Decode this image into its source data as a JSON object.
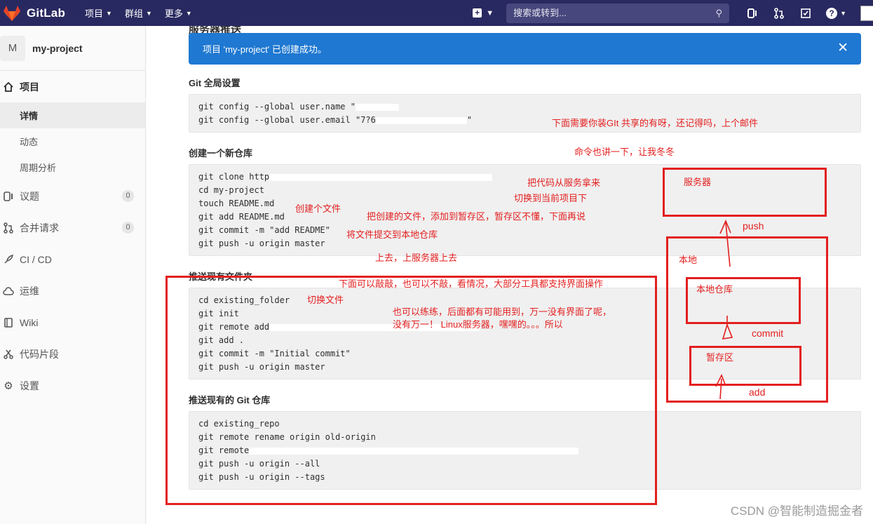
{
  "app": {
    "brand": "GitLab"
  },
  "topnav": {
    "menus": [
      "项目",
      "群组",
      "更多"
    ],
    "search_placeholder": "搜索或转到..."
  },
  "sidebar": {
    "project_initial": "M",
    "project_name": "my-project",
    "project_section": "项目",
    "sub_items": [
      "详情",
      "动态",
      "周期分析"
    ],
    "items": [
      {
        "label": "议题",
        "count": "0"
      },
      {
        "label": "合并请求",
        "count": "0"
      },
      {
        "label": "CI / CD"
      },
      {
        "label": "运维"
      },
      {
        "label": "Wiki"
      },
      {
        "label": "代码片段"
      },
      {
        "label": "设置"
      }
    ]
  },
  "main": {
    "cut_title": "服务器推送",
    "alert": "项目 'my-project' 已创建成功。",
    "sections": [
      {
        "title": "Git 全局设置",
        "lines": [
          "git config --global user.name \"",
          "git config --global user.email \"7?6"
        ]
      },
      {
        "title": "创建一个新仓库",
        "lines": [
          "git clone http",
          "cd my-project",
          "touch README.md",
          "git add README.md",
          "git commit -m \"add README\"",
          "git push -u origin master"
        ]
      },
      {
        "title": "推送现有文件夹",
        "lines": [
          "cd existing_folder",
          "git init",
          "git remote add",
          "git add .",
          "git commit -m \"Initial commit\"",
          "git push -u origin master"
        ]
      },
      {
        "title": "推送现有的 Git 仓库",
        "lines": [
          "cd existing_repo",
          "git remote rename origin old-origin",
          "git remote",
          "git push -u origin --all",
          "git push -u origin --tags"
        ]
      }
    ]
  },
  "annotations": {
    "install": "下面需要你装GIt 共享的有呀，还记得吗，上个邮件",
    "commands": "命令也讲一下，让我冬冬",
    "pull": "把代码从服务拿来",
    "switch_project": "切换到当前项目下",
    "create_file": "创建个文件",
    "add_stage": "把创建的文件，添加到暂存区，暂存区不懂，下面再说",
    "commit_local": "将文件提交到本地仓库",
    "push_server": "上去，上服务器上去",
    "optional": "下面可以敲敲，也可以不敲，看情况，大部分工具都支持界面操作",
    "switch_file": "切换文件",
    "practice1": "也可以练练，后面都有可能用到，万一没有界面了呢，",
    "practice2": "没有万一！ Linux服务器，嘿嘿的。。。所以",
    "server": "服务器",
    "push": "push",
    "local": "本地",
    "local_repo": "本地仓库",
    "commit": "commit",
    "staging": "暂存区",
    "add": "add"
  },
  "watermark": "CSDN @智能制造掘金者",
  "colors": {
    "nav": "#292961",
    "alert": "#1f78d1",
    "annotation": "#e31f1f"
  }
}
